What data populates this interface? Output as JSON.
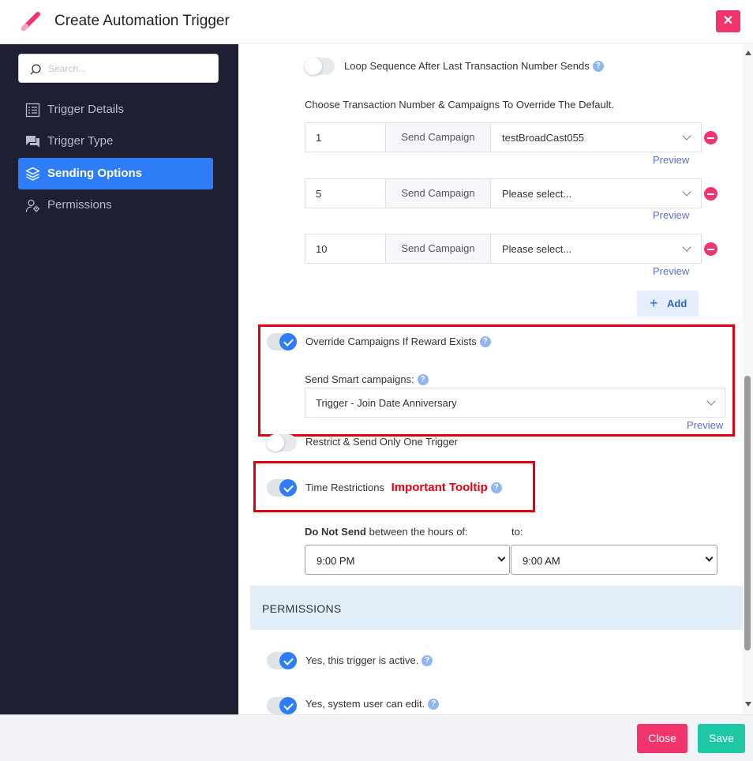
{
  "header": {
    "title": "Create Automation Trigger",
    "close_symbol": "✕"
  },
  "sidebar": {
    "search_placeholder": "Search...",
    "items": [
      {
        "label": "Trigger Details",
        "icon": "list-icon"
      },
      {
        "label": "Trigger Type",
        "icon": "chat-icon"
      },
      {
        "label": "Sending Options",
        "icon": "layers-icon",
        "active": true
      },
      {
        "label": "Permissions",
        "icon": "user-gear-icon"
      }
    ]
  },
  "sending": {
    "loop_label": "Loop Sequence After Last Transaction Number Sends",
    "choose_label": "Choose Transaction Number & Campaigns To Override The Default.",
    "addon_label": "Send Campaign",
    "preview_label": "Preview",
    "rows": [
      {
        "number": "1",
        "campaign": "testBroadCast055"
      },
      {
        "number": "5",
        "campaign": "Please select..."
      },
      {
        "number": "10",
        "campaign": "Please select..."
      }
    ],
    "add_label": "Add",
    "override_label": "Override Campaigns If Reward Exists",
    "smart_label": "Send Smart campaigns:",
    "smart_value": "Trigger - Join Date Anniversary",
    "restrict_label": "Restrict & Send Only One Trigger",
    "time_label": "Time Restrictions",
    "tooltip_label": "Important Tooltip",
    "do_not_send_bold": "Do Not Send",
    "do_not_send_rest": " between the hours of:",
    "to_label": "to:",
    "from_time": "9:00 PM",
    "to_time": "9:00 AM"
  },
  "permissions": {
    "header": "PERMISSIONS",
    "active_label": "Yes, this trigger is active.",
    "edit_label": "Yes, system user can edit."
  },
  "footer": {
    "close_label": "Close",
    "save_label": "Save"
  },
  "colors": {
    "accent": "#2f7df6",
    "danger": "#f2346e",
    "success": "#1fc8a5",
    "highlight": "#e1000f",
    "sidebar_bg": "#1f1f33"
  }
}
